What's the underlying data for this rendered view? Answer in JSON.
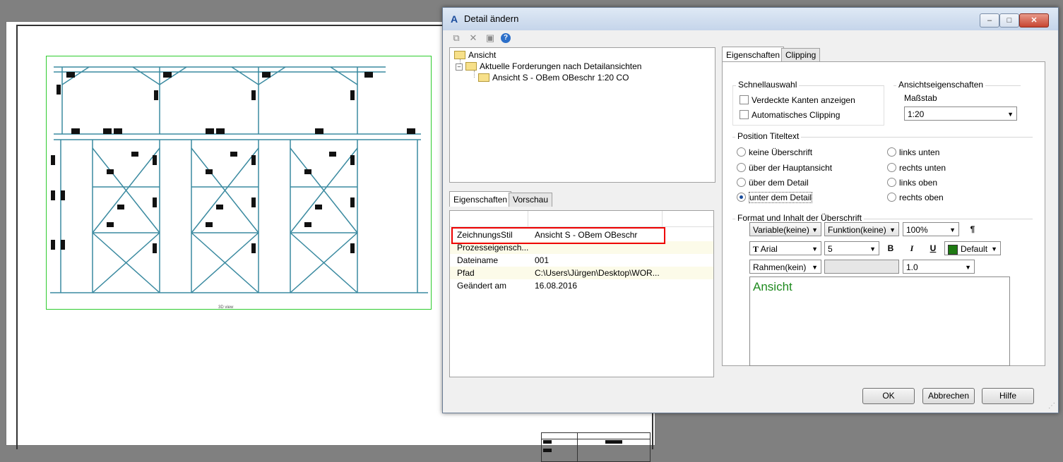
{
  "drawing": {
    "view_label": "3D view"
  },
  "dialog": {
    "title": "Detail ändern",
    "buttons": {
      "minimize": "–",
      "maximize": "□",
      "close": "✕"
    },
    "toolbar": [
      {
        "name": "copy-icon",
        "glyph": "⧉"
      },
      {
        "name": "delete-icon",
        "glyph": "✕"
      },
      {
        "name": "save-icon",
        "glyph": "▣"
      },
      {
        "name": "help-icon",
        "glyph": "?"
      }
    ],
    "tree": {
      "root": "Ansicht",
      "child": "Aktuelle Forderungen nach Detailansichten",
      "leaf": "Ansicht S - OBem OBeschr 1:20 CO"
    },
    "left_tabs": {
      "props": "Eigenschaften",
      "preview": "Vorschau"
    },
    "properties": [
      {
        "key": "ZeichnungsStil",
        "value": "Ansicht S - OBem OBeschr"
      },
      {
        "key": "Prozesseigensch...",
        "value": ""
      },
      {
        "key": "Dateiname",
        "value": "001"
      },
      {
        "key": "Pfad",
        "value": "C:\\Users\\Jürgen\\Desktop\\WOR..."
      },
      {
        "key": "Geändert am",
        "value": "16.08.2016"
      }
    ],
    "right_tabs": {
      "props": "Eigenschaften",
      "clipping": "Clipping"
    },
    "schnellauswahl": {
      "label": "Schnellauswahl",
      "verdeckte": "Verdeckte Kanten anzeigen",
      "auto_clip": "Automatisches Clipping"
    },
    "ansichts": {
      "label": "Ansichtseigenschaften",
      "massstab_label": "Maßstab",
      "massstab_value": "1:20"
    },
    "position": {
      "label": "Position Titeltext",
      "options": [
        "keine Überschrift",
        "über der Hauptansicht",
        "über dem Detail",
        "unter dem Detail",
        "links unten",
        "rechts unten",
        "links oben",
        "rechts oben"
      ],
      "selected": "unter dem Detail"
    },
    "format": {
      "label": "Format und Inhalt der Überschrift",
      "variable": "Variable(keine)",
      "funktion": "Funktion(keine)",
      "percent": "100%",
      "font": "Arial",
      "size": "5",
      "bold": "B",
      "italic": "I",
      "underline": "U",
      "color_label": "Default",
      "color_hex": "#1e7a12",
      "frame": "Rahmen(kein)",
      "line": "1.0",
      "text": "Ansicht"
    },
    "footer": {
      "ok": "OK",
      "cancel": "Abbrechen",
      "help": "Hilfe"
    }
  }
}
